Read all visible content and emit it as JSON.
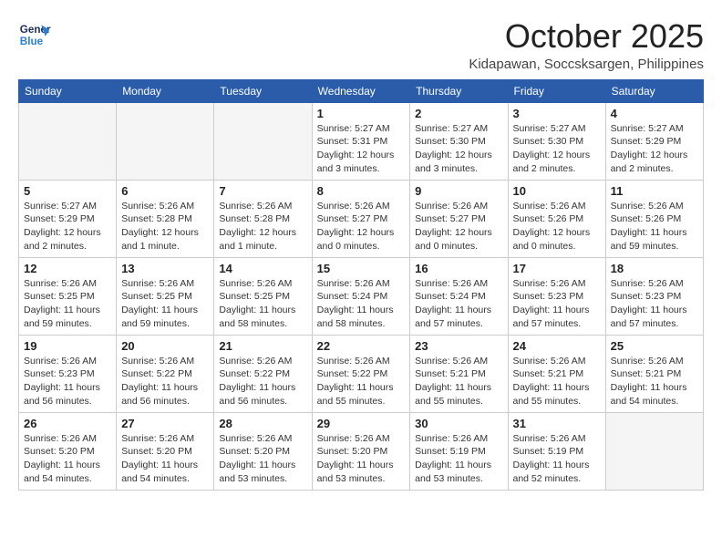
{
  "logo": {
    "line1": "General",
    "line2": "Blue"
  },
  "title": "October 2025",
  "location": "Kidapawan, Soccsksargen, Philippines",
  "weekdays": [
    "Sunday",
    "Monday",
    "Tuesday",
    "Wednesday",
    "Thursday",
    "Friday",
    "Saturday"
  ],
  "weeks": [
    [
      {
        "day": "",
        "info": ""
      },
      {
        "day": "",
        "info": ""
      },
      {
        "day": "",
        "info": ""
      },
      {
        "day": "1",
        "info": "Sunrise: 5:27 AM\nSunset: 5:31 PM\nDaylight: 12 hours\nand 3 minutes."
      },
      {
        "day": "2",
        "info": "Sunrise: 5:27 AM\nSunset: 5:30 PM\nDaylight: 12 hours\nand 3 minutes."
      },
      {
        "day": "3",
        "info": "Sunrise: 5:27 AM\nSunset: 5:30 PM\nDaylight: 12 hours\nand 2 minutes."
      },
      {
        "day": "4",
        "info": "Sunrise: 5:27 AM\nSunset: 5:29 PM\nDaylight: 12 hours\nand 2 minutes."
      }
    ],
    [
      {
        "day": "5",
        "info": "Sunrise: 5:27 AM\nSunset: 5:29 PM\nDaylight: 12 hours\nand 2 minutes."
      },
      {
        "day": "6",
        "info": "Sunrise: 5:26 AM\nSunset: 5:28 PM\nDaylight: 12 hours\nand 1 minute."
      },
      {
        "day": "7",
        "info": "Sunrise: 5:26 AM\nSunset: 5:28 PM\nDaylight: 12 hours\nand 1 minute."
      },
      {
        "day": "8",
        "info": "Sunrise: 5:26 AM\nSunset: 5:27 PM\nDaylight: 12 hours\nand 0 minutes."
      },
      {
        "day": "9",
        "info": "Sunrise: 5:26 AM\nSunset: 5:27 PM\nDaylight: 12 hours\nand 0 minutes."
      },
      {
        "day": "10",
        "info": "Sunrise: 5:26 AM\nSunset: 5:26 PM\nDaylight: 12 hours\nand 0 minutes."
      },
      {
        "day": "11",
        "info": "Sunrise: 5:26 AM\nSunset: 5:26 PM\nDaylight: 11 hours\nand 59 minutes."
      }
    ],
    [
      {
        "day": "12",
        "info": "Sunrise: 5:26 AM\nSunset: 5:25 PM\nDaylight: 11 hours\nand 59 minutes."
      },
      {
        "day": "13",
        "info": "Sunrise: 5:26 AM\nSunset: 5:25 PM\nDaylight: 11 hours\nand 59 minutes."
      },
      {
        "day": "14",
        "info": "Sunrise: 5:26 AM\nSunset: 5:25 PM\nDaylight: 11 hours\nand 58 minutes."
      },
      {
        "day": "15",
        "info": "Sunrise: 5:26 AM\nSunset: 5:24 PM\nDaylight: 11 hours\nand 58 minutes."
      },
      {
        "day": "16",
        "info": "Sunrise: 5:26 AM\nSunset: 5:24 PM\nDaylight: 11 hours\nand 57 minutes."
      },
      {
        "day": "17",
        "info": "Sunrise: 5:26 AM\nSunset: 5:23 PM\nDaylight: 11 hours\nand 57 minutes."
      },
      {
        "day": "18",
        "info": "Sunrise: 5:26 AM\nSunset: 5:23 PM\nDaylight: 11 hours\nand 57 minutes."
      }
    ],
    [
      {
        "day": "19",
        "info": "Sunrise: 5:26 AM\nSunset: 5:23 PM\nDaylight: 11 hours\nand 56 minutes."
      },
      {
        "day": "20",
        "info": "Sunrise: 5:26 AM\nSunset: 5:22 PM\nDaylight: 11 hours\nand 56 minutes."
      },
      {
        "day": "21",
        "info": "Sunrise: 5:26 AM\nSunset: 5:22 PM\nDaylight: 11 hours\nand 56 minutes."
      },
      {
        "day": "22",
        "info": "Sunrise: 5:26 AM\nSunset: 5:22 PM\nDaylight: 11 hours\nand 55 minutes."
      },
      {
        "day": "23",
        "info": "Sunrise: 5:26 AM\nSunset: 5:21 PM\nDaylight: 11 hours\nand 55 minutes."
      },
      {
        "day": "24",
        "info": "Sunrise: 5:26 AM\nSunset: 5:21 PM\nDaylight: 11 hours\nand 55 minutes."
      },
      {
        "day": "25",
        "info": "Sunrise: 5:26 AM\nSunset: 5:21 PM\nDaylight: 11 hours\nand 54 minutes."
      }
    ],
    [
      {
        "day": "26",
        "info": "Sunrise: 5:26 AM\nSunset: 5:20 PM\nDaylight: 11 hours\nand 54 minutes."
      },
      {
        "day": "27",
        "info": "Sunrise: 5:26 AM\nSunset: 5:20 PM\nDaylight: 11 hours\nand 54 minutes."
      },
      {
        "day": "28",
        "info": "Sunrise: 5:26 AM\nSunset: 5:20 PM\nDaylight: 11 hours\nand 53 minutes."
      },
      {
        "day": "29",
        "info": "Sunrise: 5:26 AM\nSunset: 5:20 PM\nDaylight: 11 hours\nand 53 minutes."
      },
      {
        "day": "30",
        "info": "Sunrise: 5:26 AM\nSunset: 5:19 PM\nDaylight: 11 hours\nand 53 minutes."
      },
      {
        "day": "31",
        "info": "Sunrise: 5:26 AM\nSunset: 5:19 PM\nDaylight: 11 hours\nand 52 minutes."
      },
      {
        "day": "",
        "info": ""
      }
    ]
  ]
}
